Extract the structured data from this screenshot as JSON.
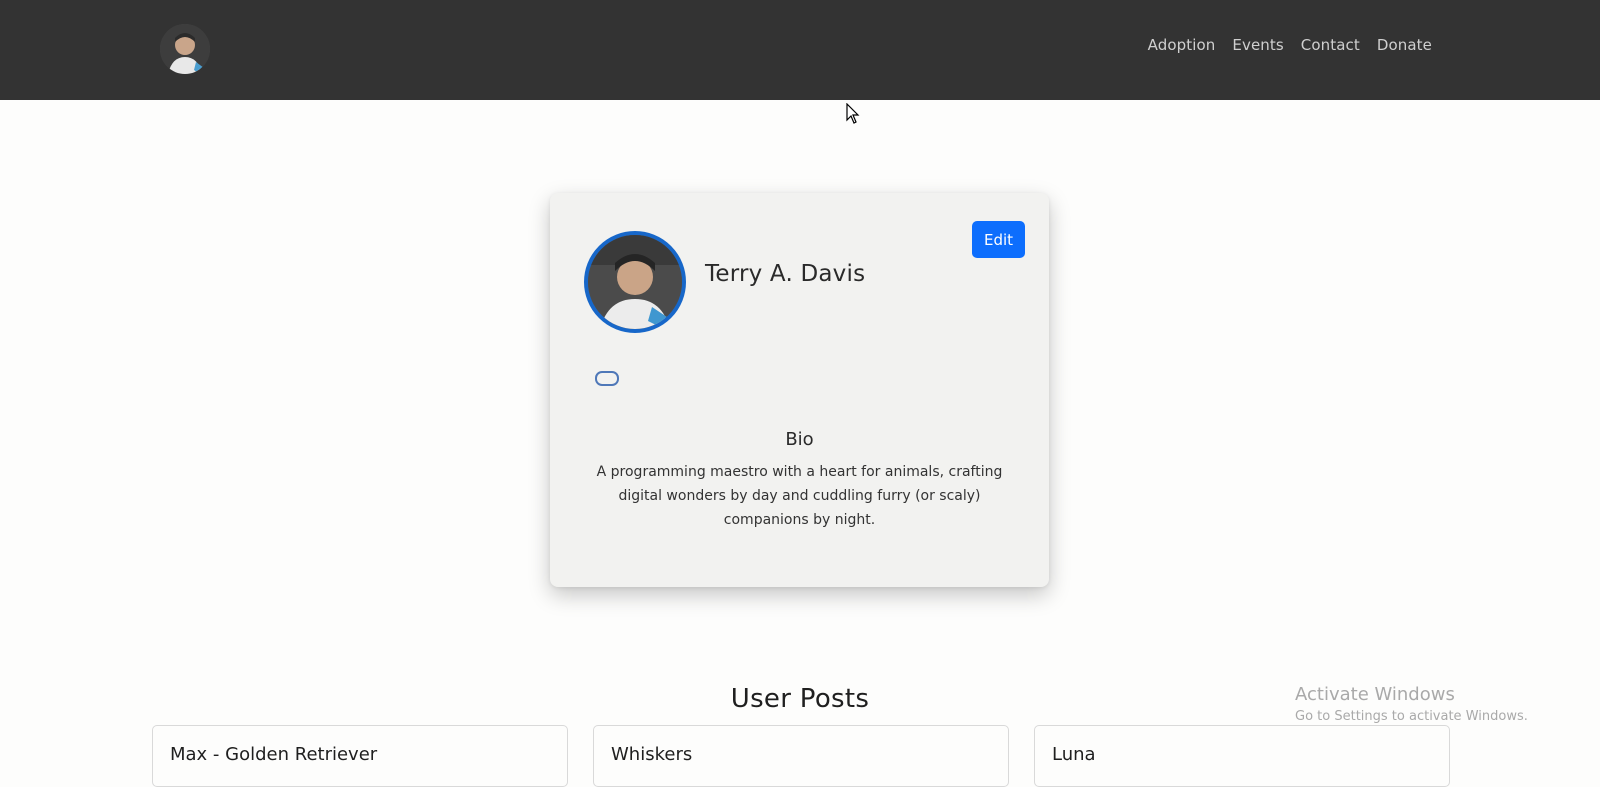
{
  "navbar": {
    "links": [
      "Adoption",
      "Events",
      "Contact",
      "Donate"
    ]
  },
  "profile": {
    "name": "Terry A. Davis",
    "edit_label": "Edit",
    "bio_heading": "Bio",
    "bio_text": "A programming maestro with a heart for animals, crafting digital wonders by day and cuddling furry (or scaly) companions by night.",
    "accent_color": "#1767c9"
  },
  "posts": {
    "heading": "User Posts",
    "items": [
      {
        "title": "Max - Golden Retriever"
      },
      {
        "title": "Whiskers"
      },
      {
        "title": "Luna"
      }
    ]
  },
  "watermark": {
    "title": "Activate Windows",
    "subtitle": "Go to Settings to activate Windows."
  },
  "colors": {
    "navbar_bg": "#333333",
    "primary_button": "#0d6efd",
    "page_bg": "#fdfdfc"
  }
}
